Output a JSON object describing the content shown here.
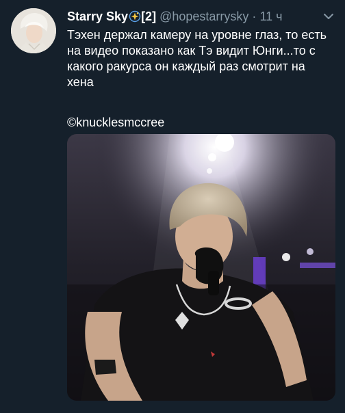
{
  "tweet": {
    "display_name": "Starry Sky",
    "badge": "[2]",
    "handle": "@hopestarrysky",
    "separator": "·",
    "time": "11 ч",
    "text": "Тэхен держал камеру на уровне глаз, то есть на видео показано как Тэ видит Юнги...то с какого ракурса он каждый раз смотрит на хена",
    "credit": "©knucklesmccree"
  },
  "icons": {
    "name_emoji": "sparkle-icon",
    "menu": "chevron-down-icon"
  },
  "colors": {
    "background": "#15202b",
    "primary_text": "#ffffff",
    "secondary_text": "#8899a6"
  }
}
